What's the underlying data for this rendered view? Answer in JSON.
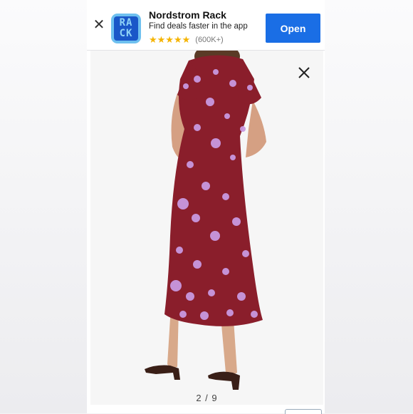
{
  "banner": {
    "close_icon": "close-icon",
    "app_icon_text_top": "RA",
    "app_icon_text_bottom": "CK",
    "app_name": "Nordstrom Rack",
    "tagline": "Find deals faster in the app",
    "stars": "★★★★★",
    "review_count": "(600K+)",
    "open_label": "Open",
    "colors": {
      "open_button": "#1a6ee5",
      "stars": "#f5b400",
      "icon_bg": "#6ec0ef"
    }
  },
  "viewer": {
    "close_icon": "close-icon",
    "image": "person wearing a burgundy floral midi dress, back view",
    "counter": "2 / 9"
  }
}
